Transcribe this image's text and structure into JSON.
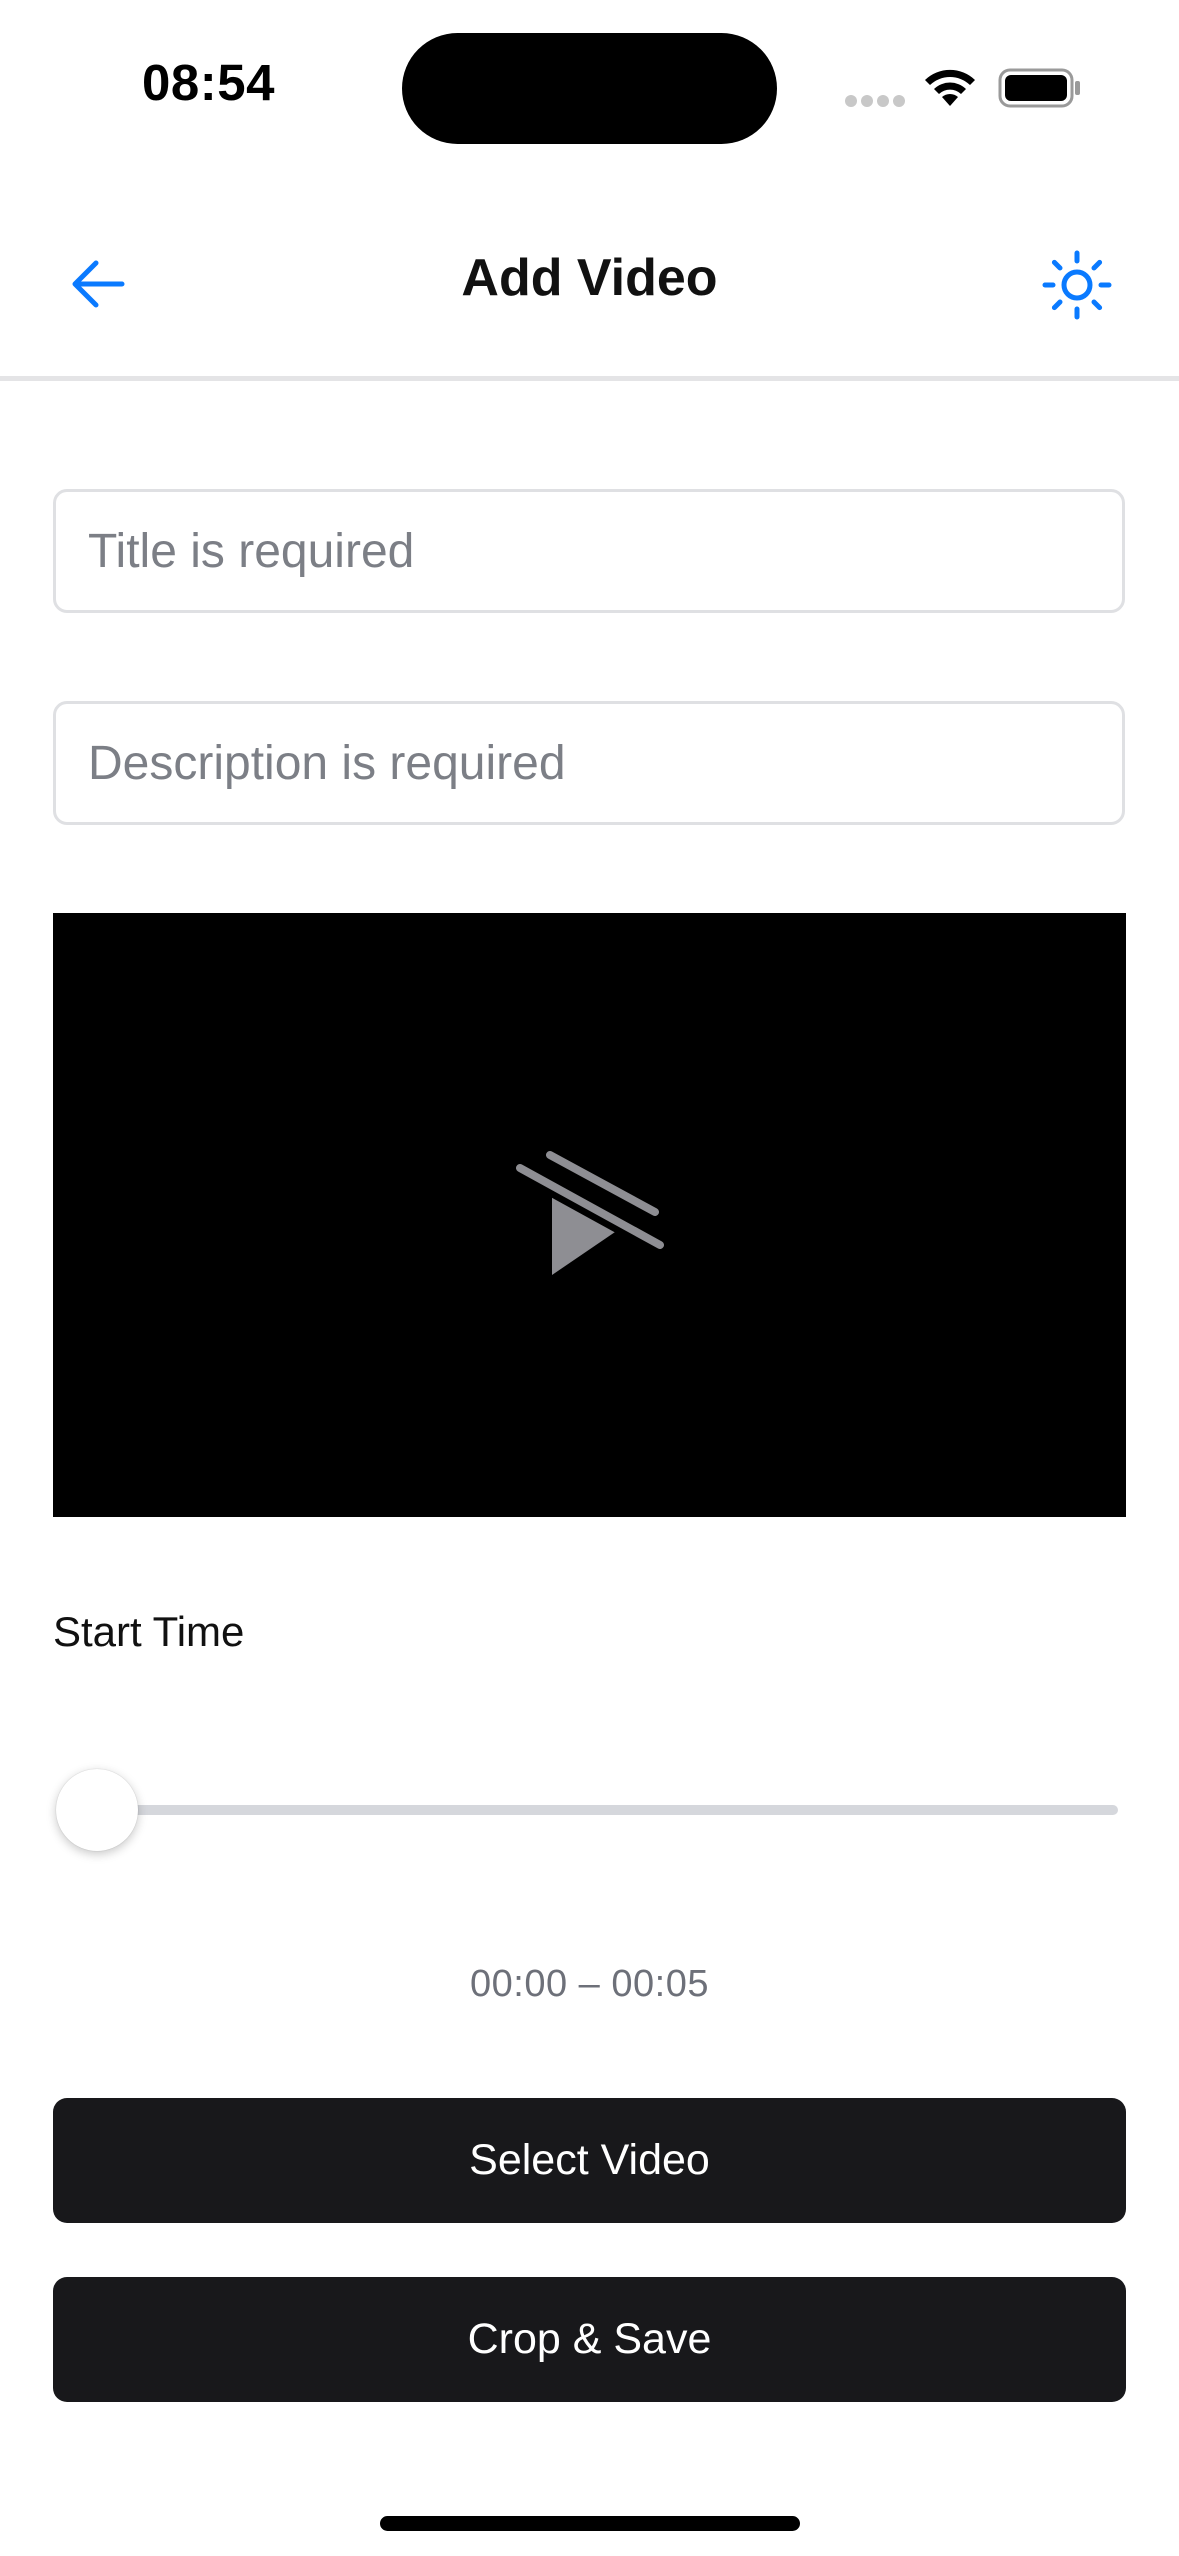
{
  "status_bar": {
    "time": "08:54"
  },
  "header": {
    "title": "Add Video",
    "back_icon": "arrow-left-icon",
    "theme_icon": "sun-icon",
    "accent_color": "#0a7aff"
  },
  "form": {
    "title_placeholder": "Title is required",
    "title_value": "",
    "description_placeholder": "Description is required",
    "description_value": ""
  },
  "video": {
    "state_icon": "video-unavailable-icon"
  },
  "start_time": {
    "label": "Start Time",
    "slider_value_fraction": 0,
    "range_text": "00:00 – 00:05"
  },
  "actions": {
    "select_video_label": "Select Video",
    "crop_save_label": "Crop & Save"
  }
}
